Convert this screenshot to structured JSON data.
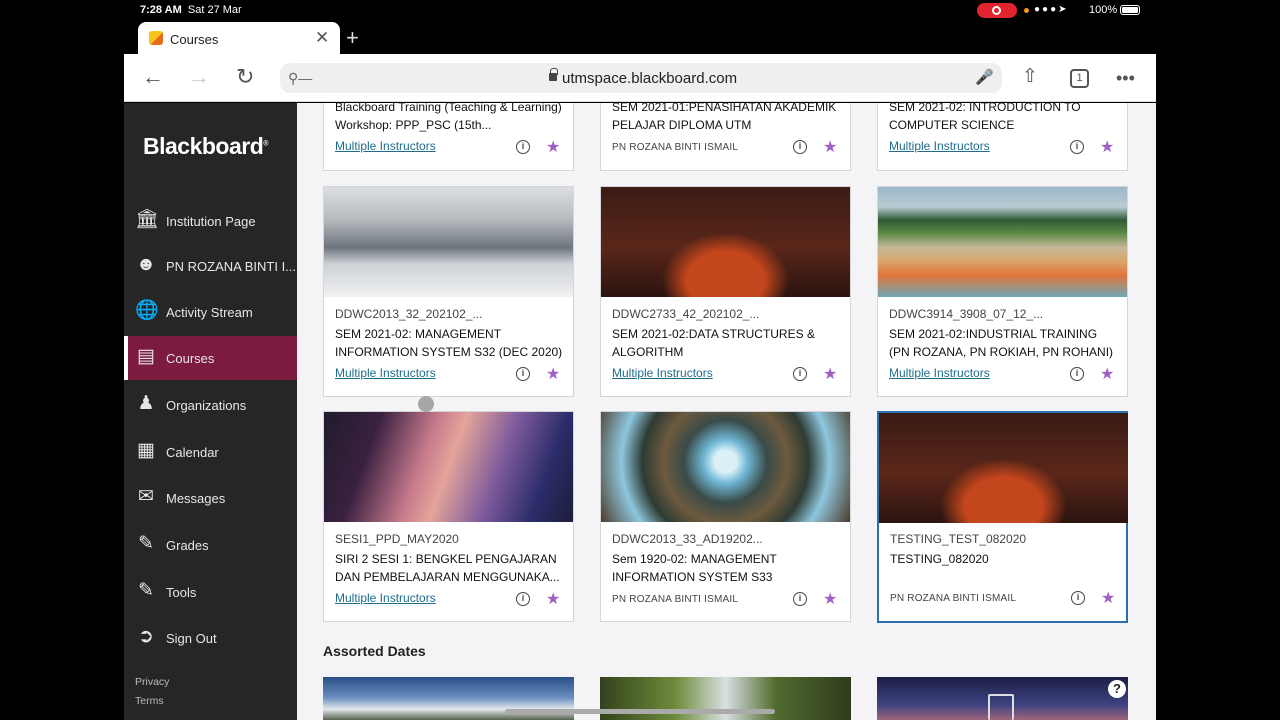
{
  "status_bar": {
    "time": "7:28 AM",
    "date": "Sat 27 Mar",
    "battery": "100%"
  },
  "browser": {
    "tab_title": "Courses",
    "url": "utmspace.blackboard.com",
    "tab_count": "1"
  },
  "sidebar": {
    "logo": "Blackboard",
    "items": [
      {
        "label": "Institution Page",
        "icon": "institution-icon"
      },
      {
        "label": "PN ROZANA BINTI I...",
        "icon": "user-icon"
      },
      {
        "label": "Activity Stream",
        "icon": "globe-icon"
      },
      {
        "label": "Courses",
        "icon": "courses-icon"
      },
      {
        "label": "Organizations",
        "icon": "organizations-icon"
      },
      {
        "label": "Calendar",
        "icon": "calendar-icon"
      },
      {
        "label": "Messages",
        "icon": "envelope-icon"
      },
      {
        "label": "Grades",
        "icon": "grades-icon"
      },
      {
        "label": "Tools",
        "icon": "tools-icon"
      },
      {
        "label": "Sign Out",
        "icon": "sign-out-icon"
      }
    ],
    "footer": [
      "Privacy",
      "Terms"
    ]
  },
  "courses_top": [
    {
      "name": "Blackboard Training (Teaching & Learning) Workshop: PPP_PSC (15th...",
      "instructor": "Multiple Instructors"
    },
    {
      "name": "SEM 2021-01:PENASIHATAN AKADEMIK PELAJAR DIPLOMA UTM",
      "instructor": "PN ROZANA BINTI ISMAIL"
    },
    {
      "name": "SEM 2021-02: INTRODUCTION TO COMPUTER SCIENCE",
      "instructor": "Multiple Instructors"
    }
  ],
  "courses": [
    {
      "code": "DDWC2013_32_202102_...",
      "name": "SEM 2021-02: MANAGEMENT INFORMATION SYSTEM S32 (DEC 2020)",
      "instructor": "Multiple Instructors",
      "image": "clouds-mountain"
    },
    {
      "code": "DDWC2733_42_202102_...",
      "name": "SEM 2021-02:DATA STRUCTURES & ALGORITHM",
      "instructor": "Multiple Instructors",
      "image": "red-rock-night"
    },
    {
      "code": "DDWC3914_3908_07_12_...",
      "name": "SEM 2021-02:INDUSTRIAL TRAINING (PN ROZANA, PN ROKIAH, PN ROHANI)",
      "instructor": "Multiple Instructors",
      "image": "hot-spring"
    },
    {
      "code": "SESI1_PPD_MAY2020",
      "name": "SIRI 2 SESI 1: BENGKEL PENGAJARAN DAN PEMBELAJARAN MENGGUNAKA...",
      "instructor": "Multiple Instructors",
      "image": "canyon"
    },
    {
      "code": "DDWC2013_33_AD19202...",
      "name": "Sem 1920-02: MANAGEMENT INFORMATION SYSTEM S33",
      "instructor": "PN ROZANA BINTI ISMAIL",
      "image": "forest-canopy"
    },
    {
      "code": "TESTING_TEST_082020",
      "name": "TESTING_082020",
      "instructor": "PN ROZANA BINTI ISMAIL",
      "image": "red-rock-night"
    }
  ],
  "section_title": "Assorted Dates"
}
